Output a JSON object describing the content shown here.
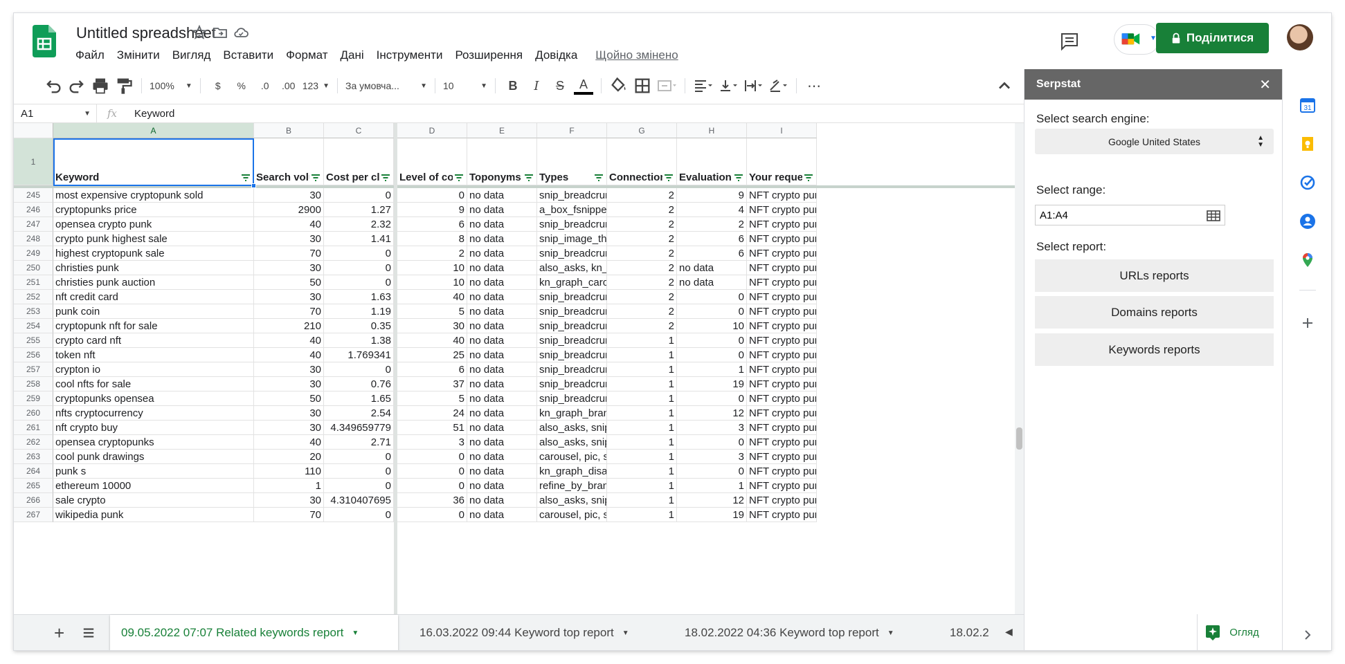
{
  "header": {
    "title": "Untitled spreadsheet",
    "menu": [
      "Файл",
      "Змінити",
      "Вигляд",
      "Вставити",
      "Формат",
      "Дані",
      "Інструменти",
      "Розширення",
      "Довідка"
    ],
    "last_edit": "Щойно змінено",
    "share_label": "Поділитися"
  },
  "toolbar": {
    "zoom": "100%",
    "currency": "$",
    "percent": "%",
    "decrease_decimal": ".0",
    "increase_decimal": ".00",
    "format_more": "123",
    "font": "За умовча...",
    "font_size": "10",
    "bold": "B",
    "italic": "I",
    "strike": "S",
    "text_color": "A",
    "more": "⋯"
  },
  "formula_bar": {
    "cell_ref": "A1",
    "fx": "fx",
    "value": "Keyword"
  },
  "grid": {
    "columns": [
      "A",
      "B",
      "C",
      "D",
      "E",
      "F",
      "G",
      "H",
      "I"
    ],
    "header_row_number": "1",
    "headers": [
      "Keyword",
      "Search volu",
      "Cost per clic",
      "Level of con",
      "Toponyms",
      "Types",
      "Connection",
      "Evaluation c",
      "Your reques"
    ],
    "rows": [
      [
        "245",
        "most expensive cryptopunk sold",
        "30",
        "0",
        "0",
        "no data",
        "snip_breadcruml",
        "2",
        "9",
        "NFT crypto punk"
      ],
      [
        "246",
        "cryptopunks price",
        "2900",
        "1.27",
        "9",
        "no data",
        "a_box_fsnippet,",
        "2",
        "4",
        "NFT crypto punk"
      ],
      [
        "247",
        "opensea crypto punk",
        "40",
        "2.32",
        "6",
        "no data",
        "snip_breadcruml",
        "2",
        "2",
        "NFT crypto punk"
      ],
      [
        "248",
        "crypto punk highest sale",
        "30",
        "1.41",
        "8",
        "no data",
        "snip_image_thur",
        "2",
        "6",
        "NFT crypto punk"
      ],
      [
        "249",
        "highest cryptopunk sale",
        "70",
        "0",
        "2",
        "no data",
        "snip_breadcruml",
        "2",
        "6",
        "NFT crypto punk"
      ],
      [
        "250",
        "christies punk",
        "30",
        "0",
        "10",
        "no data",
        "also_asks, kn_g",
        "2",
        "no data",
        "NFT crypto punk"
      ],
      [
        "251",
        "christies punk auction",
        "50",
        "0",
        "10",
        "no data",
        "kn_graph_carou",
        "2",
        "no data",
        "NFT crypto punk"
      ],
      [
        "252",
        "nft credit card",
        "30",
        "1.63",
        "40",
        "no data",
        "snip_breadcruml",
        "2",
        "0",
        "NFT crypto punk"
      ],
      [
        "253",
        "punk coin",
        "70",
        "1.19",
        "5",
        "no data",
        "snip_breadcruml",
        "2",
        "0",
        "NFT crypto punk"
      ],
      [
        "254",
        "cryptopunk nft for sale",
        "210",
        "0.35",
        "30",
        "no data",
        "snip_breadcruml",
        "2",
        "10",
        "NFT crypto punk"
      ],
      [
        "255",
        "crypto card nft",
        "40",
        "1.38",
        "40",
        "no data",
        "snip_breadcruml",
        "1",
        "0",
        "NFT crypto punk"
      ],
      [
        "256",
        "token nft",
        "40",
        "1.769341",
        "25",
        "no data",
        "snip_breadcruml",
        "1",
        "0",
        "NFT crypto punk"
      ],
      [
        "257",
        "crypton io",
        "30",
        "0",
        "6",
        "no data",
        "snip_breadcruml",
        "1",
        "1",
        "NFT crypto punk"
      ],
      [
        "258",
        "cool nfts for sale",
        "30",
        "0.76",
        "37",
        "no data",
        "snip_breadcruml",
        "1",
        "19",
        "NFT crypto punk"
      ],
      [
        "259",
        "cryptopunks opensea",
        "50",
        "1.65",
        "5",
        "no data",
        "snip_breadcruml",
        "1",
        "0",
        "NFT crypto punk"
      ],
      [
        "260",
        "nfts cryptocurrency",
        "30",
        "2.54",
        "24",
        "no data",
        "kn_graph_brand",
        "1",
        "12",
        "NFT crypto punk"
      ],
      [
        "261",
        "nft crypto buy",
        "30",
        "4.349659779",
        "51",
        "no data",
        "also_asks, snip_",
        "1",
        "3",
        "NFT crypto punk"
      ],
      [
        "262",
        "opensea cryptopunks",
        "40",
        "2.71",
        "3",
        "no data",
        "also_asks, snip_",
        "1",
        "0",
        "NFT crypto punk"
      ],
      [
        "263",
        "cool punk drawings",
        "20",
        "0",
        "0",
        "no data",
        "carousel, pic, sn",
        "1",
        "3",
        "NFT crypto punk"
      ],
      [
        "264",
        "punk s",
        "110",
        "0",
        "0",
        "no data",
        "kn_graph_disam",
        "1",
        "0",
        "NFT crypto punk"
      ],
      [
        "265",
        "ethereum 10000",
        "1",
        "0",
        "0",
        "no data",
        "refine_by_brand",
        "1",
        "1",
        "NFT crypto punk"
      ],
      [
        "266",
        "sale crypto",
        "30",
        "4.310407695",
        "36",
        "no data",
        "also_asks, snip_",
        "1",
        "12",
        "NFT crypto punk"
      ],
      [
        "267",
        "wikipedia punk",
        "70",
        "0",
        "0",
        "no data",
        "carousel, pic, sn",
        "1",
        "19",
        "NFT crypto punk"
      ]
    ]
  },
  "sheet_tabs": [
    "09.05.2022 07:07 Related keywords report",
    "16.03.2022 09:44 Keyword top report",
    "18.02.2022 04:36 Keyword top report",
    "18.02.2"
  ],
  "explore_label": "Огляд",
  "serpstat": {
    "title": "Serpstat",
    "engine_label": "Select search engine:",
    "engine_value": "Google United States",
    "range_label": "Select range:",
    "range_value": "A1:A4",
    "report_label": "Select report:",
    "buttons": [
      "URLs reports",
      "Domains reports",
      "Keywords reports"
    ]
  },
  "colors": {
    "brand_green": "#188038",
    "selection_blue": "#1a73e8",
    "panel_header": "#666666"
  }
}
